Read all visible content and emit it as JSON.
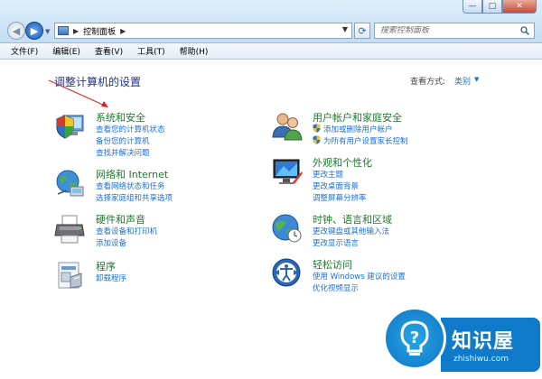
{
  "window": {
    "address": "控制面板",
    "search_placeholder": "搜索控制面板",
    "buttons": {
      "minimize": "—",
      "maximize": "□",
      "close": "✕"
    }
  },
  "menu": [
    "文件(F)",
    "编辑(E)",
    "查看(V)",
    "工具(T)",
    "帮助(H)"
  ],
  "main": {
    "title": "调整计算机的设置",
    "view_by_label": "查看方式:",
    "view_by_value": "类别"
  },
  "categories": [
    {
      "title": "系统和安全",
      "icon": "shield-computer-icon",
      "links": [
        "查看您的计算机状态",
        "备份您的计算机",
        "查找并解决问题"
      ]
    },
    {
      "title": "网络和 Internet",
      "icon": "network-globe-icon",
      "links": [
        "查看网络状态和任务",
        "选择家庭组和共享选项"
      ]
    },
    {
      "title": "硬件和声音",
      "icon": "printer-icon",
      "links": [
        "查看设备和打印机",
        "添加设备"
      ]
    },
    {
      "title": "程序",
      "icon": "programs-icon",
      "links": [
        "卸载程序"
      ]
    },
    {
      "title": "用户帐户和家庭安全",
      "icon": "users-icon",
      "links": [
        "添加或删除用户帐户",
        "为所有用户设置家长控制"
      ]
    },
    {
      "title": "外观和个性化",
      "icon": "monitor-icon",
      "links": [
        "更改主题",
        "更改桌面背景",
        "调整屏幕分辨率"
      ]
    },
    {
      "title": "时钟、语言和区域",
      "icon": "clock-globe-icon",
      "links": [
        "更改键盘或其他输入法",
        "更改显示语言"
      ]
    },
    {
      "title": "轻松访问",
      "icon": "ease-of-access-icon",
      "links": [
        "使用 Windows 建议的设置",
        "优化视频显示"
      ]
    }
  ],
  "watermark": {
    "title": "知识屋",
    "sub": "zhishiwu.com"
  },
  "colors": {
    "link": "#1c6fd6",
    "category_title": "#1d7a2e",
    "heading": "#1e3287",
    "annotation": "#e02020"
  }
}
